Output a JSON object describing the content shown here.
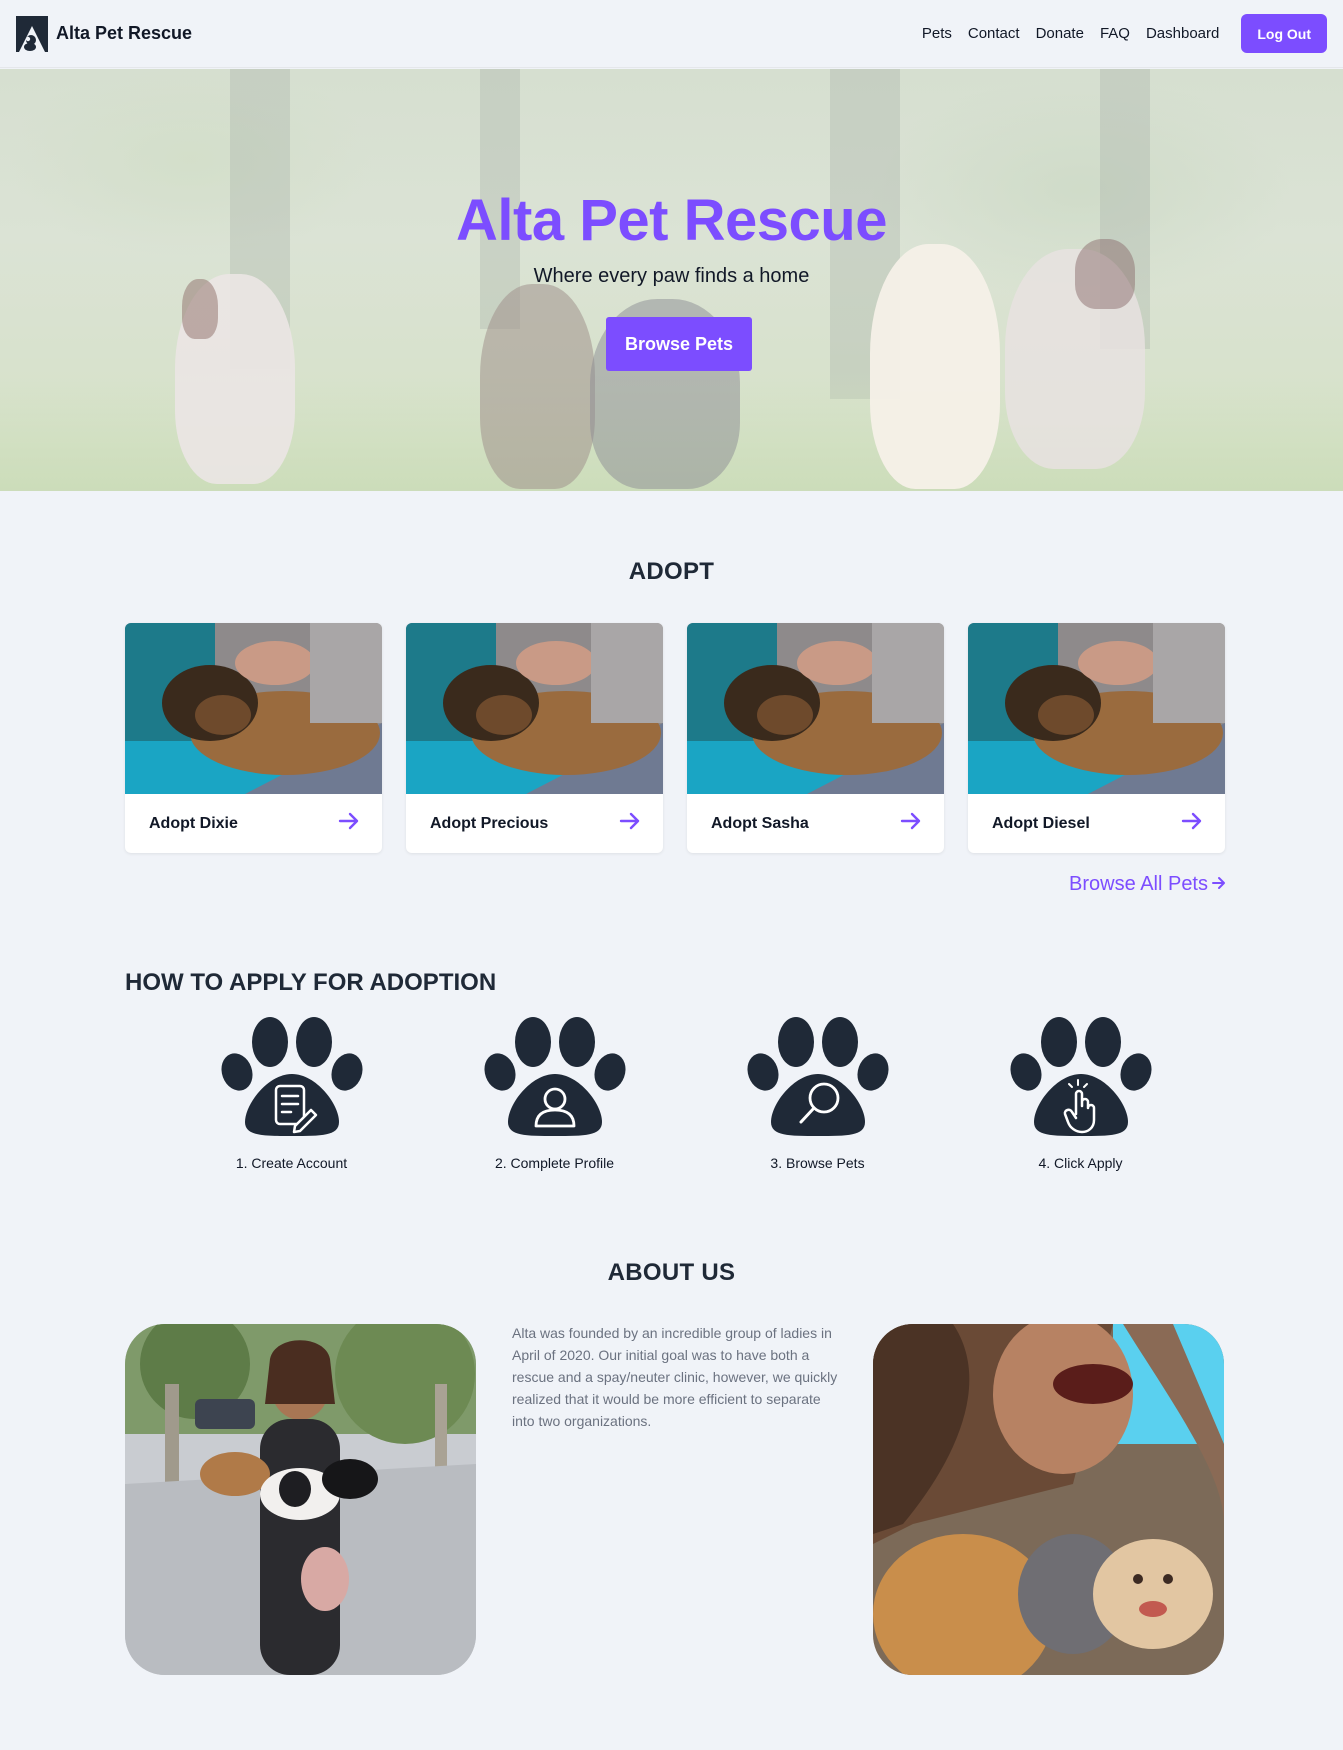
{
  "nav": {
    "brand": "Alta Pet Rescue",
    "links": [
      "Pets",
      "Contact",
      "Donate",
      "FAQ",
      "Dashboard"
    ],
    "logout_label": "Log Out"
  },
  "hero": {
    "title": "Alta Pet Rescue",
    "subtitle": "Where every paw finds a home",
    "button_label": "Browse Pets"
  },
  "adopt": {
    "title": "ADOPT",
    "cards": [
      {
        "label": "Adopt Dixie"
      },
      {
        "label": "Adopt Precious"
      },
      {
        "label": "Adopt Sasha"
      },
      {
        "label": "Adopt Diesel"
      }
    ],
    "browse_all_label": "Browse All Pets"
  },
  "apply": {
    "title": "HOW TO APPLY FOR ADOPTION",
    "steps": [
      {
        "label": "1. Create Account",
        "icon": "document-edit-icon"
      },
      {
        "label": "2. Complete Profile",
        "icon": "user-icon"
      },
      {
        "label": "3. Browse Pets",
        "icon": "search-icon"
      },
      {
        "label": "4. Click Apply",
        "icon": "tap-hand-icon"
      }
    ]
  },
  "about": {
    "title": "ABOUT US",
    "text": "Alta was founded by an incredible group of ladies in April of 2020. Our initial goal was to have both a rescue and a spay/neuter clinic, however, we quickly realized that it would be more efficient to separate into two organizations."
  },
  "colors": {
    "accent": "#7c4dff",
    "dark": "#1f2937",
    "background": "#f0f3f8"
  }
}
